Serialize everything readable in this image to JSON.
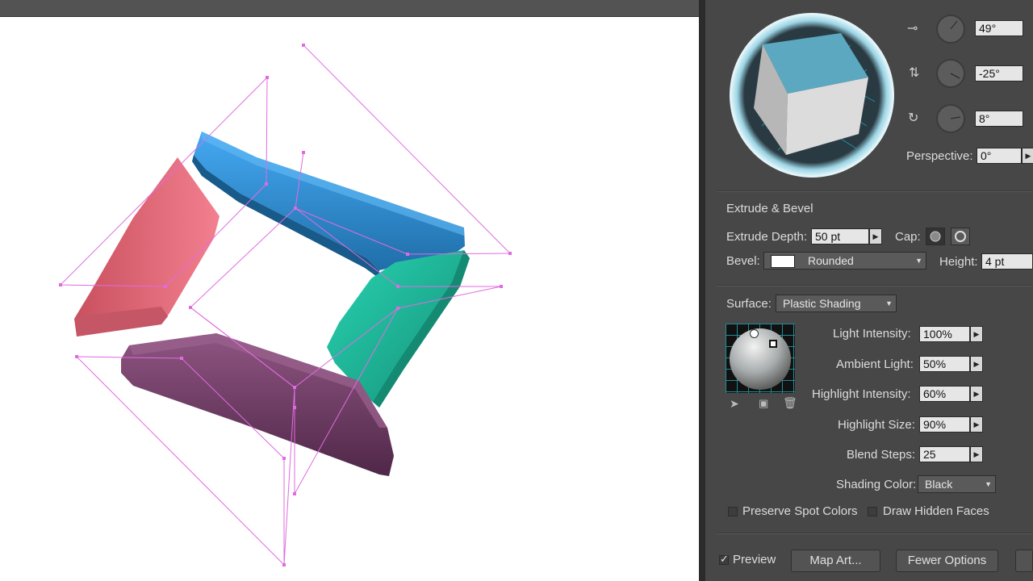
{
  "rotation": {
    "x_value": "49°",
    "y_value": "-25°",
    "z_value": "8°",
    "perspective_label": "Perspective:",
    "perspective_value": "0°"
  },
  "extrude": {
    "section_title": "Extrude & Bevel",
    "depth_label": "Extrude Depth:",
    "depth_value": "50 pt",
    "cap_label": "Cap:",
    "bevel_label": "Bevel:",
    "bevel_value": "Rounded",
    "height_label": "Height:",
    "height_value": "4 pt"
  },
  "surface": {
    "label": "Surface:",
    "value": "Plastic Shading",
    "light_intensity_label": "Light Intensity:",
    "light_intensity_value": "100%",
    "ambient_light_label": "Ambient Light:",
    "ambient_light_value": "50%",
    "highlight_intensity_label": "Highlight Intensity:",
    "highlight_intensity_value": "60%",
    "highlight_size_label": "Highlight Size:",
    "highlight_size_value": "90%",
    "blend_steps_label": "Blend Steps:",
    "blend_steps_value": "25",
    "shading_color_label": "Shading Color:",
    "shading_color_value": "Black"
  },
  "options": {
    "preserve_spot_colors": "Preserve Spot Colors",
    "draw_hidden_faces": "Draw Hidden Faces",
    "preview": "Preview",
    "map_art": "Map Art...",
    "fewer_options": "Fewer Options"
  },
  "colors": {
    "blue_segment": "#2f97ea",
    "pink_segment": "#ef7786",
    "teal_segment": "#22c9a6",
    "purple_segment": "#7d4670",
    "bounding_box": "#e06be0",
    "panel_bg": "#474747",
    "cube_top": "#5ba8c0"
  }
}
